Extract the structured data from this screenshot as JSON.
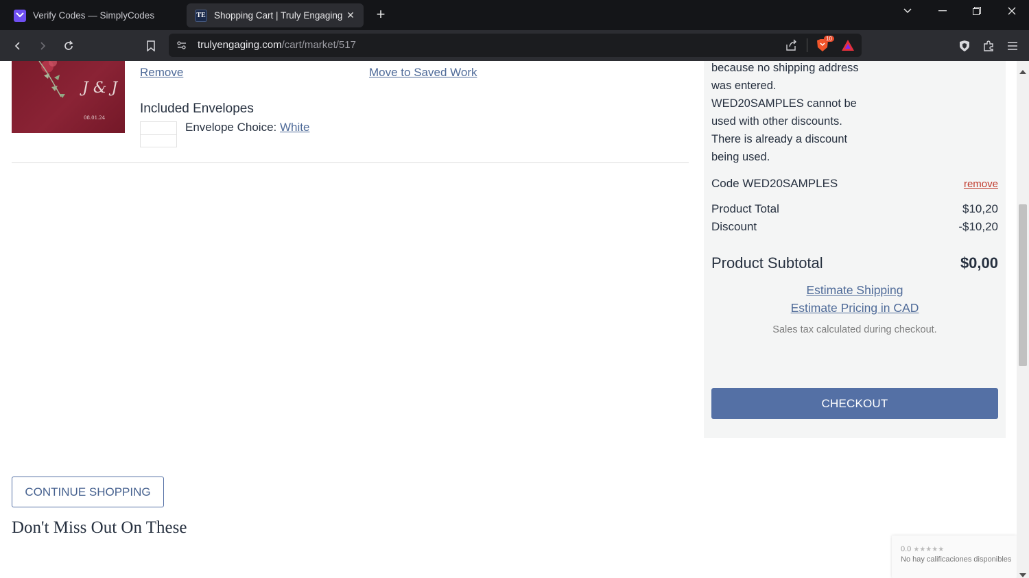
{
  "browser": {
    "tabs": [
      {
        "title": "Verify Codes — SimplyCodes",
        "favicon": "simplycodes-icon",
        "active": false
      },
      {
        "title": "Shopping Cart | Truly Engaging",
        "favicon": "trulyengaging-icon",
        "favicon_text": "TE",
        "active": true
      }
    ],
    "url_domain": "trulyengaging.com",
    "url_path": "/cart/market/517",
    "brave_badge": "10"
  },
  "cart_item": {
    "image_initials": "J & J",
    "image_date": "08.01.24",
    "remove_label": "Remove",
    "move_saved_label": "Move to Saved Work",
    "envelopes_heading": "Included Envelopes",
    "envelope_choice_label": "Envelope Choice:",
    "envelope_choice_value": "White"
  },
  "summary": {
    "messages": [
      "because no shipping address",
      "was entered.",
      "WED20SAMPLES cannot be",
      "used with other discounts.",
      "There is already a discount",
      "being used."
    ],
    "code_label": "Code WED20SAMPLES",
    "code_remove": "remove",
    "product_total_label": "Product Total",
    "product_total_value": "$10,20",
    "discount_label": "Discount",
    "discount_value": "-$10,20",
    "subtotal_label": "Product Subtotal",
    "subtotal_value": "$0,00",
    "estimate_shipping": "Estimate Shipping",
    "estimate_cad": "Estimate Pricing in CAD",
    "tax_note": "Sales tax calculated during checkout.",
    "checkout_label": "CHECKOUT"
  },
  "continue_shopping_label": "CONTINUE SHOPPING",
  "recommendations_heading": "Don't Miss Out On These",
  "rating_widget": {
    "score": "0.0",
    "stars": "★★★★★",
    "text": "No hay calificaciones disponibles"
  },
  "colors": {
    "accent": "#5470a5",
    "link": "#4e6a98",
    "remove_red": "#c0392b",
    "product_maroon": "#7a1a2a"
  }
}
